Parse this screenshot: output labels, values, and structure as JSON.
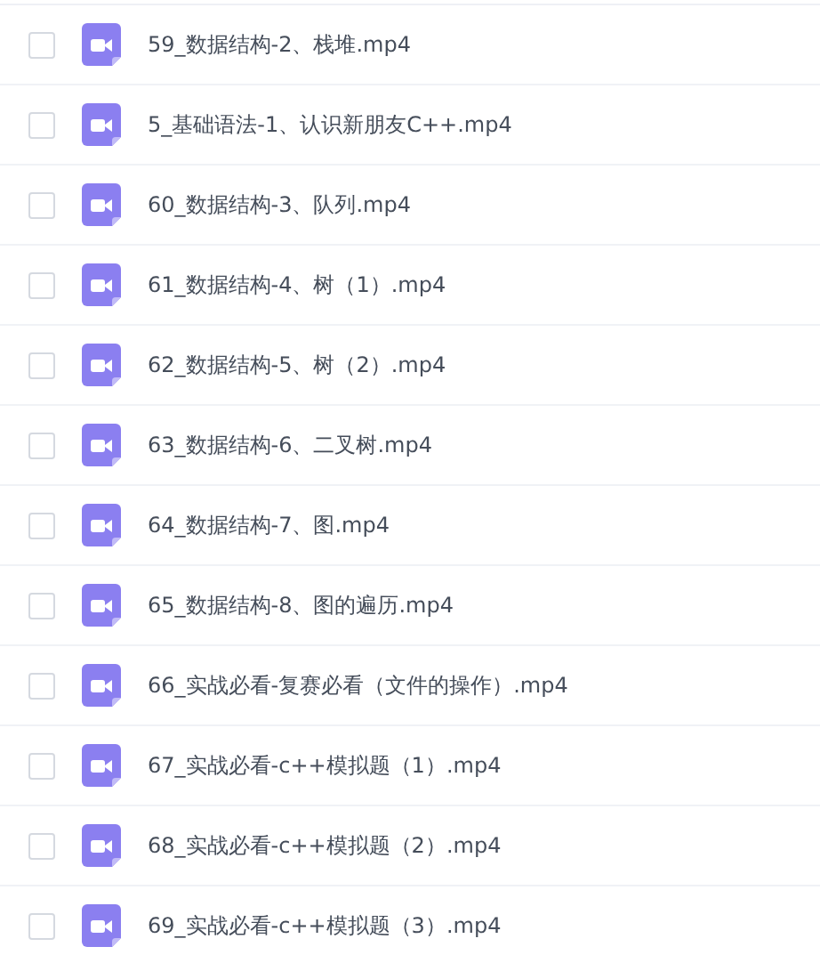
{
  "files": [
    {
      "name": "59_数据结构-2、栈堆.mp4",
      "checked": false
    },
    {
      "name": "5_基础语法-1、认识新朋友C++.mp4",
      "checked": false
    },
    {
      "name": "60_数据结构-3、队列.mp4",
      "checked": false
    },
    {
      "name": "61_数据结构-4、树（1）.mp4",
      "checked": false
    },
    {
      "name": "62_数据结构-5、树（2）.mp4",
      "checked": false
    },
    {
      "name": "63_数据结构-6、二叉树.mp4",
      "checked": false
    },
    {
      "name": "64_数据结构-7、图.mp4",
      "checked": false
    },
    {
      "name": "65_数据结构-8、图的遍历.mp4",
      "checked": false
    },
    {
      "name": "66_实战必看-复赛必看（文件的操作）.mp4",
      "checked": false
    },
    {
      "name": "67_实战必看-c++模拟题（1）.mp4",
      "checked": false
    },
    {
      "name": "68_实战必看-c++模拟题（2）.mp4",
      "checked": false
    },
    {
      "name": "69_实战必看-c++模拟题（3）.mp4",
      "checked": false
    }
  ]
}
